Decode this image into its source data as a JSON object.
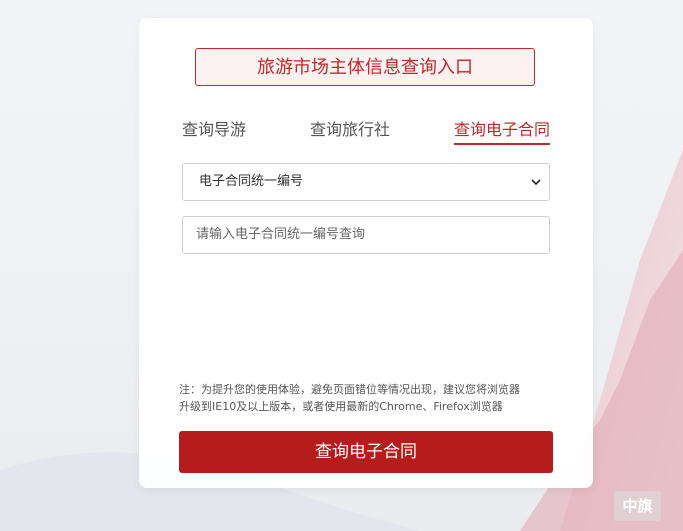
{
  "portal": {
    "title": "旅游市场主体信息查询入口"
  },
  "tabs": [
    {
      "label": "查询导游"
    },
    {
      "label": "查询旅行社"
    },
    {
      "label": "查询电子合同"
    }
  ],
  "form": {
    "select_value": "电子合同统一编号",
    "input_placeholder": "请输入电子合同统一编号查询"
  },
  "note": {
    "line1": "注：为提升您的使用体验，避免页面错位等情况出现，建议您将浏览器",
    "line2": "升级到IE10及以上版本，或者使用最新的Chrome、Firefox浏览器"
  },
  "submit": {
    "label": "查询电子合同"
  },
  "watermark": {
    "text": "中旗"
  },
  "colors": {
    "accent": "#c0282a",
    "button": "#b71c1c"
  }
}
